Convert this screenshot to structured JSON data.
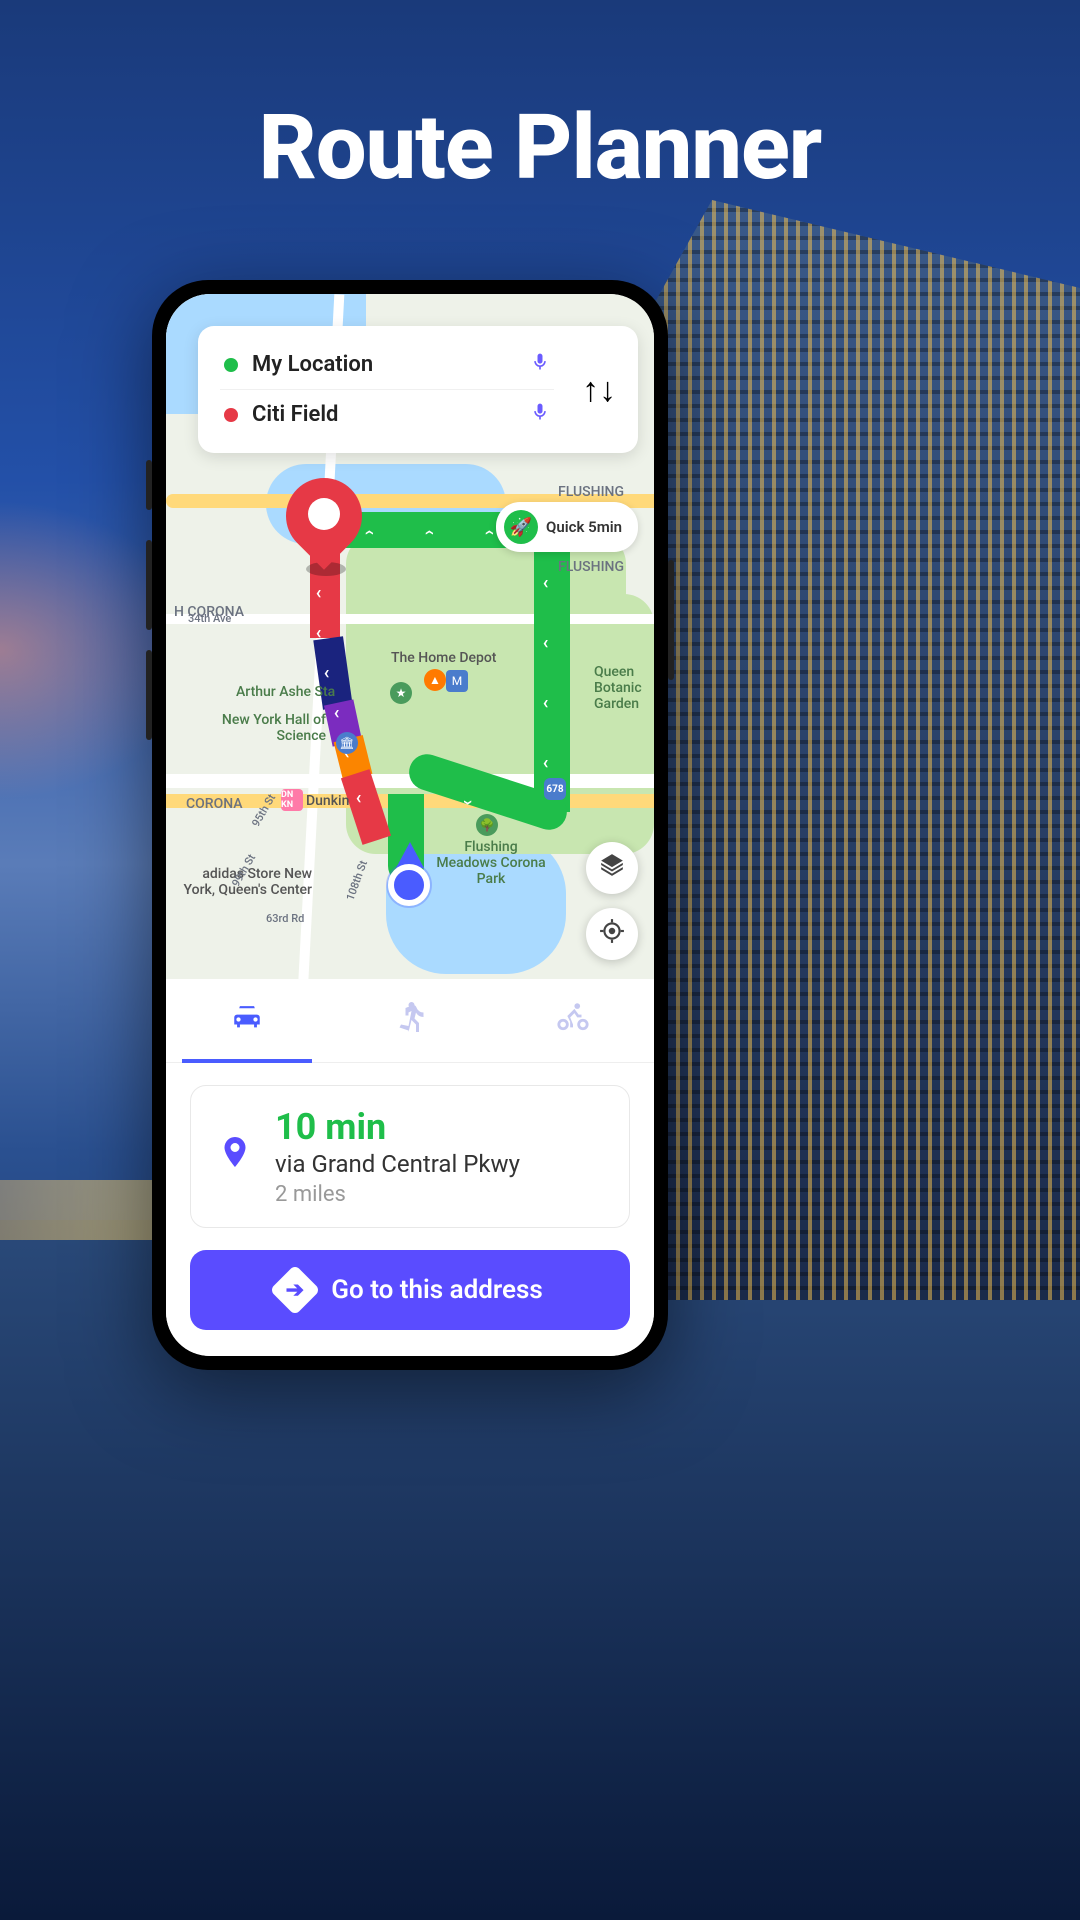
{
  "page_title": "Route Planner",
  "search": {
    "origin_label": "My Location",
    "destination_label": "Citi Field"
  },
  "map": {
    "quick_badge": "Quick 5min",
    "labels": {
      "flushing1": "FLUSHING",
      "flushing2": "FLUSHING",
      "corona1": "H CORONA",
      "corona2": "CORONA",
      "ave34": "34th Ave",
      "depot": "The Home Depot",
      "ashe": "Arthur Ashe Sta",
      "nyhs": "New York Hall of Science",
      "queenbg": "Queen Botanic Garden",
      "dunkin": "Dunkin",
      "fmp": "Flushing Meadows Corona Park",
      "adidas": "adidas Store New York, Queen's Center",
      "rd63": "63rd Rd",
      "st95": "95th St",
      "st99": "99th St",
      "st108": "108th St",
      "dn": "DN KN",
      "shield": "678"
    }
  },
  "tabs": {
    "car": "car",
    "walk": "walk",
    "bike": "bike"
  },
  "route": {
    "time": "10 min",
    "via": "via Grand Central Pkwy",
    "distance": "2 miles"
  },
  "go_button": "Go to this address"
}
